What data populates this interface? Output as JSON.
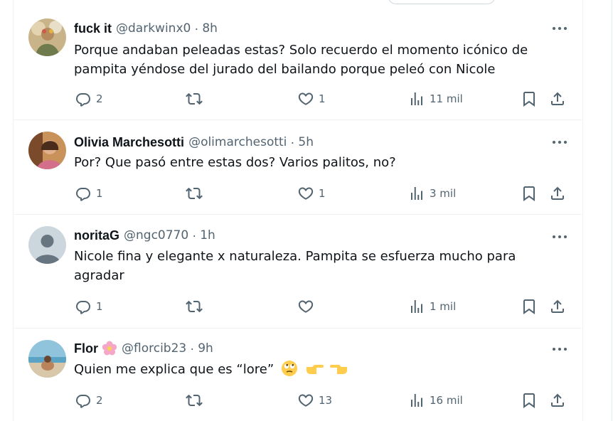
{
  "tweets": [
    {
      "name": "fuck it",
      "handle": "@darkwinx0",
      "sep": "·",
      "time": "8h",
      "text_line1": "Porque andaban peleadas estas? Solo recuerdo el momento icónico de",
      "text_line2": "pampita yéndose del jurado del bailando porque peleó con Nicole",
      "replies": "2",
      "retweets": "",
      "likes": "1",
      "views": "11 mil"
    },
    {
      "name": "Olivia Marchesotti",
      "handle": "@olimarchesotti",
      "sep": "·",
      "time": "5h",
      "text_line1": "Por? Que pasó entre estas dos? Varios palitos, no?",
      "replies": "1",
      "retweets": "",
      "likes": "1",
      "views": "3 mil"
    },
    {
      "name": "noritaG",
      "handle": "@ngc0770",
      "sep": "·",
      "time": "1h",
      "text_line1": "Nicole fina y elegante x naturaleza. Pampita se esfuerza mucho para",
      "text_line2": "agradar",
      "replies": "1",
      "retweets": "",
      "likes": "",
      "views": "1 mil"
    },
    {
      "name": "Flor",
      "name_badge_icon": "flower-emoji-icon",
      "handle": "@florcib23",
      "sep": "·",
      "time": "9h",
      "text_line1": "Quien me explica que es “lore”",
      "text_emojis": [
        "rolling-eyes-emoji-icon",
        "pointing-right-emoji-icon",
        "pointing-left-emoji-icon"
      ],
      "replies": "2",
      "retweets": "",
      "likes": "13",
      "views": "16 mil"
    }
  ],
  "colors": {
    "text": "#0f1419",
    "secondary": "#536471",
    "border": "#eff3f4"
  }
}
